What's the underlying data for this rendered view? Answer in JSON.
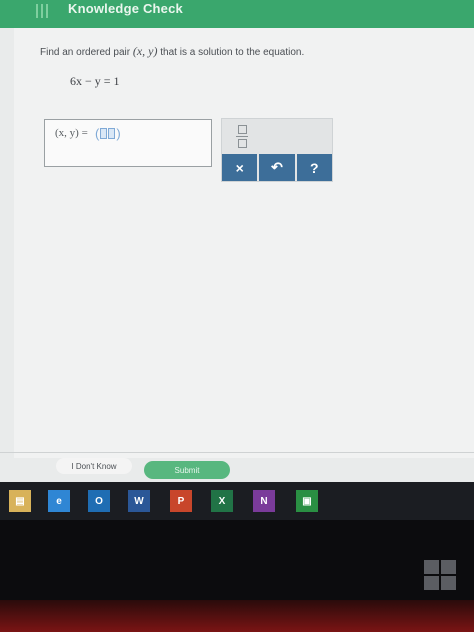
{
  "header": {
    "title": "Knowledge Check"
  },
  "question": {
    "prefix": "Find an ordered pair",
    "pair": "(x,  y)",
    "suffix": "that is a solution to the equation.",
    "equation": "6x − y = 1"
  },
  "answer": {
    "label": "(x, y) ="
  },
  "palette": {
    "keys": [
      "×",
      "↶",
      "?"
    ]
  },
  "footer": {
    "dont_know": "I Don't Know",
    "submit": "Submit"
  },
  "taskbar": {
    "icons": [
      {
        "name": "file-explorer-icon",
        "glyph": "▤",
        "color": "#d8b25a"
      },
      {
        "name": "internet-explorer-icon",
        "glyph": "e",
        "color": "#2f86d4"
      },
      {
        "name": "outlook-icon",
        "glyph": "O",
        "color": "#1f6db3"
      },
      {
        "name": "word-icon",
        "glyph": "W",
        "color": "#2b5797"
      },
      {
        "name": "powerpoint-icon",
        "glyph": "P",
        "color": "#c8462b"
      },
      {
        "name": "excel-icon",
        "glyph": "X",
        "color": "#217346"
      },
      {
        "name": "onenote-icon",
        "glyph": "N",
        "color": "#7a3b9a"
      },
      {
        "name": "store-icon",
        "glyph": "▣",
        "color": "#2a8f43"
      }
    ]
  }
}
